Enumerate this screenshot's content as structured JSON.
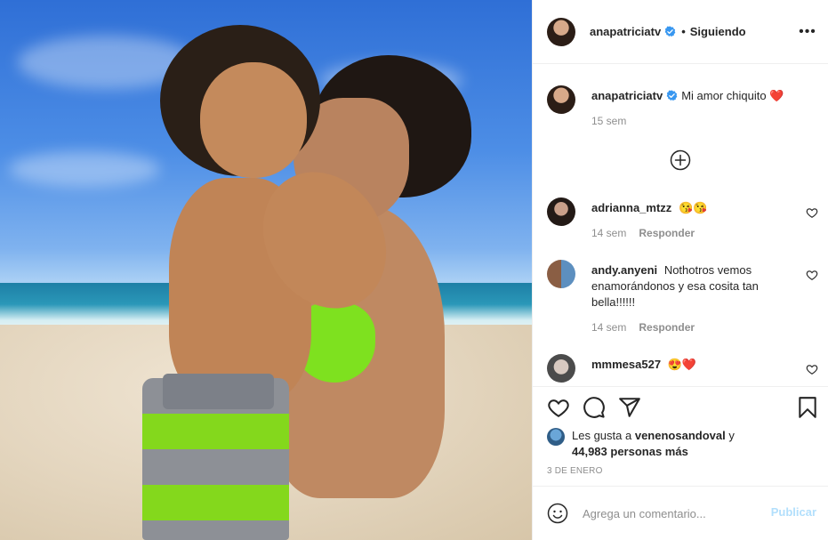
{
  "post": {
    "author": "anapatriciatv",
    "follow_status": "Siguiendo",
    "dot": "•",
    "more_glyph": "•••",
    "caption": "Mi amor chiquito",
    "caption_emoji": "❤️",
    "caption_time": "15 sem"
  },
  "comments": [
    {
      "user": "adrianna_mtzz",
      "text": "😘😘",
      "time": "14 sem",
      "reply": "Responder"
    },
    {
      "user": "andy.anyeni",
      "text": "Nothotros vemos enamorándonos y esa cosita tan bella!!!!!!",
      "time": "14 sem",
      "reply": "Responder"
    },
    {
      "user": "mmmesa527",
      "text": "😍❤️",
      "time": "",
      "reply": ""
    }
  ],
  "likes": {
    "prefix": "Les gusta a",
    "liker": "venenosandoval",
    "conj": "y",
    "others": "44,983 personas más"
  },
  "date": "3 DE ENERO",
  "compose": {
    "placeholder": "Agrega un comentario...",
    "publish": "Publicar"
  },
  "icons": {
    "verified": "verified-badge-icon",
    "more": "more-options-icon",
    "load_more": "plus-circle-icon",
    "like": "heart-icon",
    "comment": "comment-icon",
    "share": "paper-plane-icon",
    "save": "bookmark-icon",
    "emoji": "smiley-icon"
  },
  "colors": {
    "verified": "#3897f0",
    "publish_disabled": "#b2dffc",
    "muted": "#8e8e8e",
    "text": "#262626"
  }
}
